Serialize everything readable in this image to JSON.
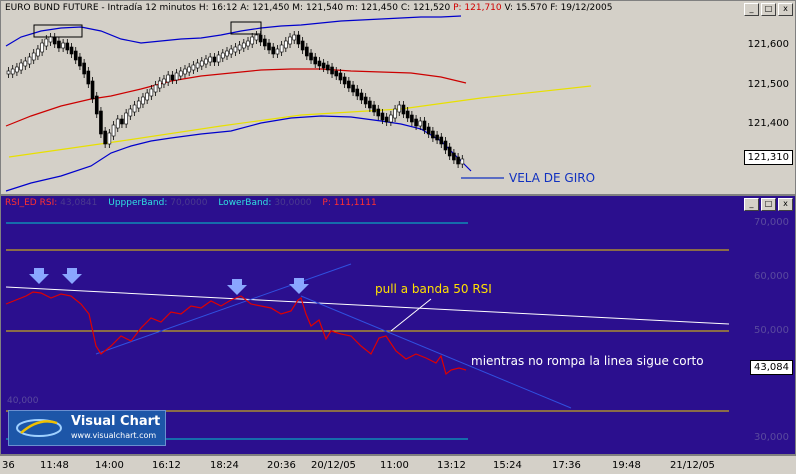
{
  "price_panel": {
    "instrument": "EURO BUND FUTURE",
    "period": "Intradía 12 minutos",
    "h": "H: 16:12",
    "a": "A: 121,450",
    "m": "M: 121,540",
    "mn": "m: 121,450",
    "c": "C: 121,520",
    "p": "P: 121,710",
    "v": "V: 15.570",
    "f": "F: 19/12/2005",
    "yticks": [
      "121,600",
      "121,500",
      "121,400"
    ],
    "last_price": "121,310",
    "annotation": "VELA DE GIRO"
  },
  "rsi_panel": {
    "rsi_label": "RSI_ED",
    "rsi_key": "RSI:",
    "rsi_val": "43,0841",
    "upper_key": "UppperBand:",
    "upper_val": "70,0000",
    "lower_key": "LowerBand:",
    "lower_val": "30,0000",
    "p_key": "P:",
    "p_val": "111,1111",
    "yticks": [
      "70,000",
      "60,000",
      "50,000",
      "30,000"
    ],
    "last_value": "43,084",
    "annotation_pull": "pull a banda 50 RSI",
    "annotation_trend": "mientras no rompa la linea sigue corto",
    "extra_label": "40,000"
  },
  "window_buttons": {
    "minimize": "_",
    "maximize": "□",
    "close": "x"
  },
  "x_axis": [
    "36",
    "11:48",
    "14:00",
    "16:12",
    "18:24",
    "20:36",
    "20/12/05",
    "11:00",
    "13:12",
    "15:24",
    "17:36",
    "19:48",
    "21/12/05"
  ],
  "logo": {
    "name": "Visual Chart",
    "url": "www.visualchart.com"
  },
  "colors": {
    "rsi_background": "#2b0f8e",
    "price_background": "#d4d0c8",
    "upper_bollinger": "#0000cc",
    "middle_average": "#cc0000",
    "trend_line_yellow": "#e8e000",
    "rsi_line": "#e00000",
    "band_yellow": "#e8c800",
    "band_cyan": "#00c8c8"
  }
}
